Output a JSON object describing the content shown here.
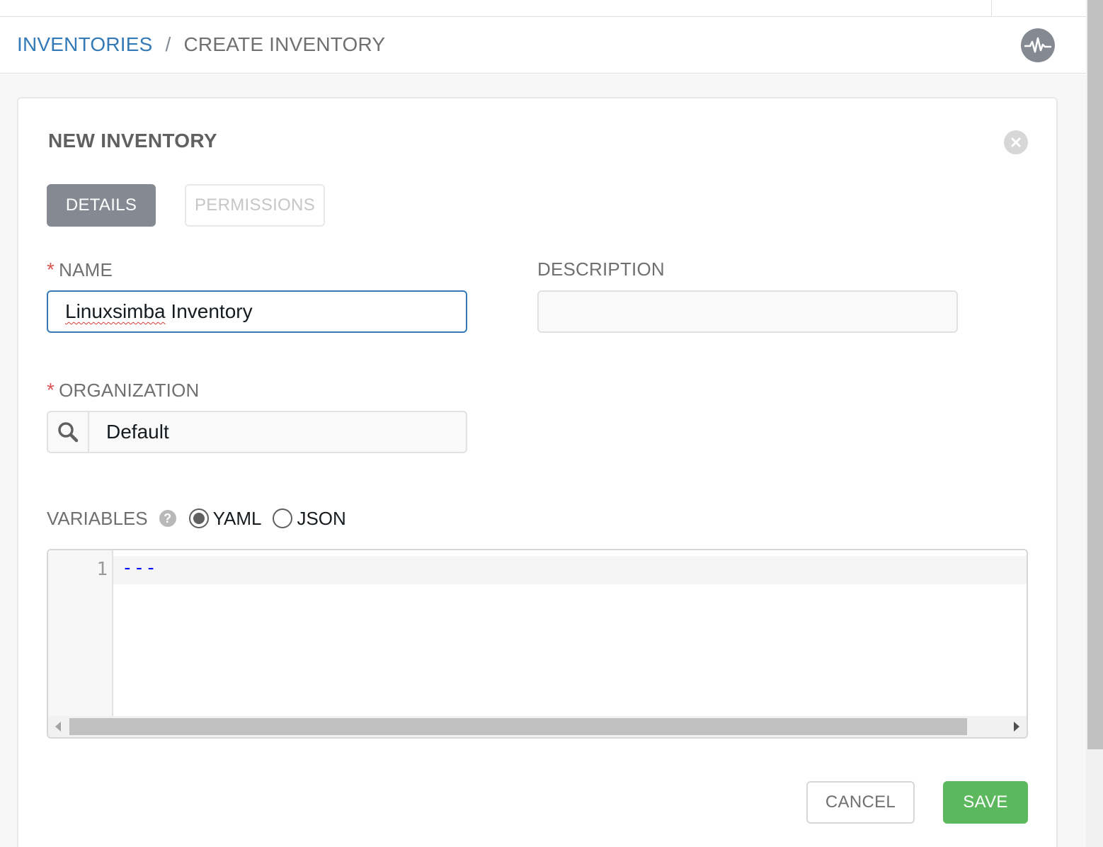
{
  "breadcrumb": {
    "parent": "INVENTORIES",
    "separator": "/",
    "current": "CREATE INVENTORY"
  },
  "header": {
    "activity_icon": "activity-stream-icon"
  },
  "form": {
    "title": "NEW INVENTORY",
    "close_icon": "close-icon",
    "tabs": [
      {
        "label": "DETAILS",
        "active": true
      },
      {
        "label": "PERMISSIONS",
        "active": false
      }
    ],
    "required_marker": "*",
    "name": {
      "label": "NAME",
      "value_misspelled": "Linuxsimba",
      "value_rest": " Inventory"
    },
    "description": {
      "label": "DESCRIPTION",
      "value": ""
    },
    "organization": {
      "label": "ORGANIZATION",
      "value": "Default"
    },
    "variables": {
      "label": "VARIABLES",
      "help_glyph": "?",
      "formats": [
        "YAML",
        "JSON"
      ],
      "selected_format": "YAML",
      "line_number": "1",
      "content": "---"
    },
    "actions": {
      "cancel": "CANCEL",
      "save": "SAVE"
    }
  },
  "colors": {
    "link": "#337ab7",
    "active_tab": "#848992",
    "required": "#d9534f",
    "save": "#5cb85c",
    "yaml_text": "#0000ff"
  }
}
